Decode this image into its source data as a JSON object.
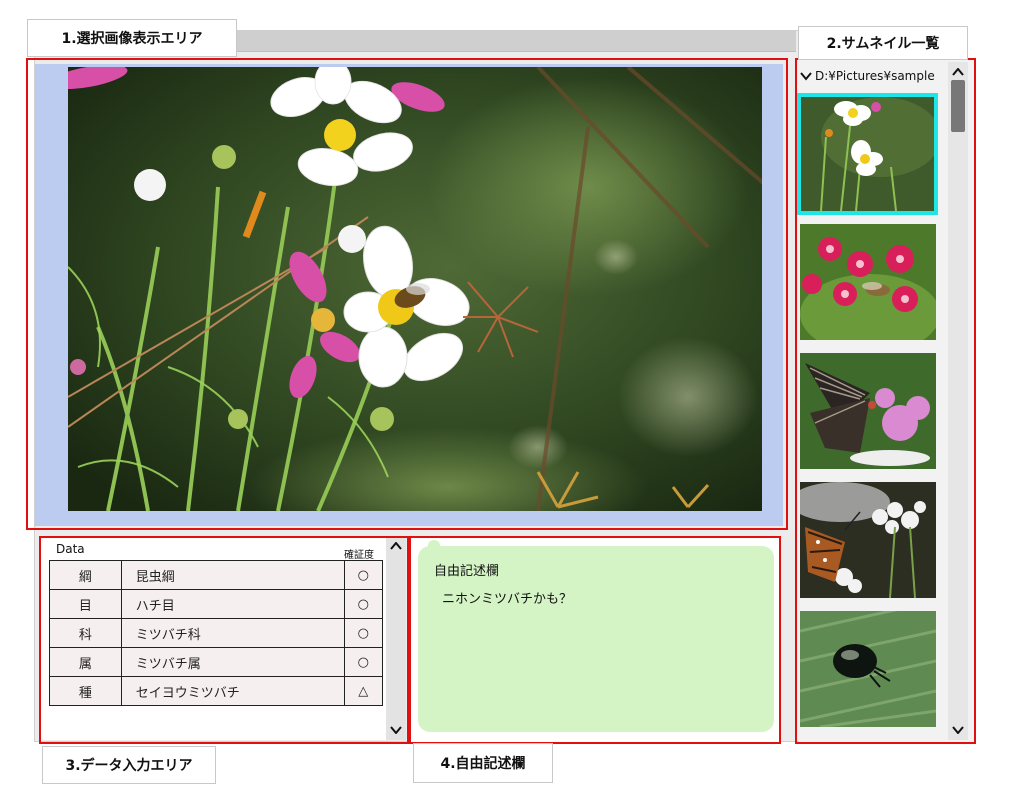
{
  "callouts": {
    "viewer": "1.選択画像表示エリア",
    "thumbnails": "2.サムネイル一覧",
    "data": "3.データ入力エリア",
    "free": "4.自由記述欄"
  },
  "thumbnails": {
    "path": "D:¥Pictures¥sample",
    "items": [
      {
        "subject": "cosmos-bee",
        "selected": true
      },
      {
        "subject": "pink-flowers-hawkmoth",
        "selected": false
      },
      {
        "subject": "swallowtail-butterfly",
        "selected": false
      },
      {
        "subject": "tiger-butterfly-white-flowers",
        "selected": false
      },
      {
        "subject": "black-beetle-on-leaf",
        "selected": false
      }
    ]
  },
  "data_panel": {
    "title": "Data",
    "cert_header": "確証度",
    "rows": [
      {
        "rank": "綱",
        "name": "昆虫綱",
        "cert": "○"
      },
      {
        "rank": "目",
        "name": "ハチ目",
        "cert": "○"
      },
      {
        "rank": "科",
        "name": "ミツバチ科",
        "cert": "○"
      },
      {
        "rank": "属",
        "name": "ミツバチ属",
        "cert": "○"
      },
      {
        "rank": "種",
        "name": "セイヨウミツバチ",
        "cert": "△"
      }
    ]
  },
  "free_text": {
    "title": "自由記述欄",
    "content": "ニホンミツバチかも？"
  },
  "colors": {
    "highlight": "#e01010",
    "viewer_bg": "#bcccf0",
    "selected_thumb": "#1ee6e6",
    "bubble": "#d5f4c6"
  }
}
